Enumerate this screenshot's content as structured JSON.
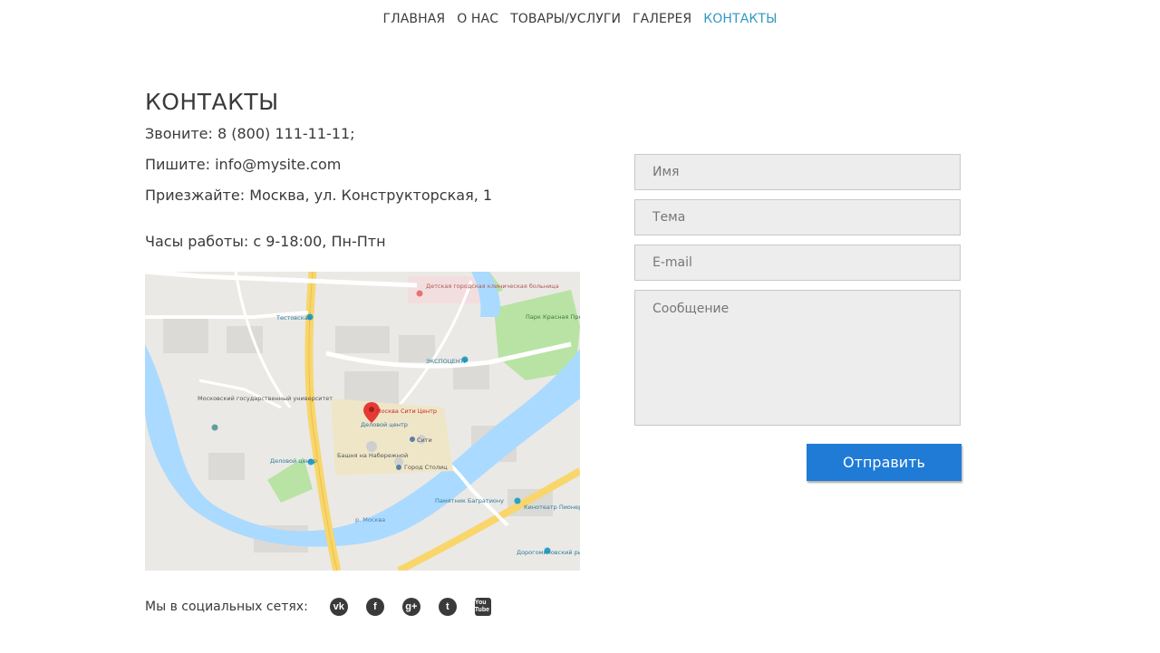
{
  "nav": {
    "items": [
      {
        "label": "ГЛАВНАЯ"
      },
      {
        "label": "О НАС"
      },
      {
        "label": "ТОВАРЫ/УСЛУГИ"
      },
      {
        "label": "ГАЛЕРЕЯ"
      },
      {
        "label": "КОНТАКТЫ"
      }
    ],
    "active_color": "#3397c4"
  },
  "contacts": {
    "title": "КОНТАКТЫ",
    "phone": "Звоните: 8 (800) 111-11-11;",
    "email": "Пишите: info@mysite.com",
    "address": "Приезжайте: Москва, ул. Конструкторская, 1",
    "hours": "Часы работы: с 9-18:00, Пн-Птн"
  },
  "map": {
    "labels": {
      "marker": "Москва Сити Центр",
      "business_center": "Деловой центр",
      "city": "Сити",
      "tower": "Башня на Набережной",
      "gorod": "Город Столиц",
      "expocentre": "ЭКСПОЦЕНТР",
      "park": "Парк Красная Пресня",
      "hospital": "Детская городская клиническая больница",
      "testovskaya": "Тестовская",
      "university": "Московский государственный университет",
      "delovoy_station": "Деловой центр",
      "bagration": "Памятник Багратиону",
      "pioneer": "Кинотеатр Пионер",
      "market": "Дорогомиловский рынок",
      "river": "р. Москва"
    },
    "water_color": "#aadaff",
    "road_color": "#f8d66b",
    "park_color": "#b8e3a4"
  },
  "social": {
    "label": "Мы в социальных сетях:",
    "icons": [
      {
        "name": "vk-icon",
        "glyph": "vk"
      },
      {
        "name": "facebook-icon",
        "glyph": "f"
      },
      {
        "name": "google-plus-icon",
        "glyph": "g+"
      },
      {
        "name": "twitter-icon",
        "glyph": "t"
      },
      {
        "name": "youtube-icon",
        "glyph": "You Tube"
      }
    ]
  },
  "form": {
    "name_placeholder": "Имя",
    "subject_placeholder": "Тема",
    "email_placeholder": "E-mail",
    "message_placeholder": "Сообщение",
    "submit_label": "Отправить",
    "accent": "#1f7bd6"
  }
}
